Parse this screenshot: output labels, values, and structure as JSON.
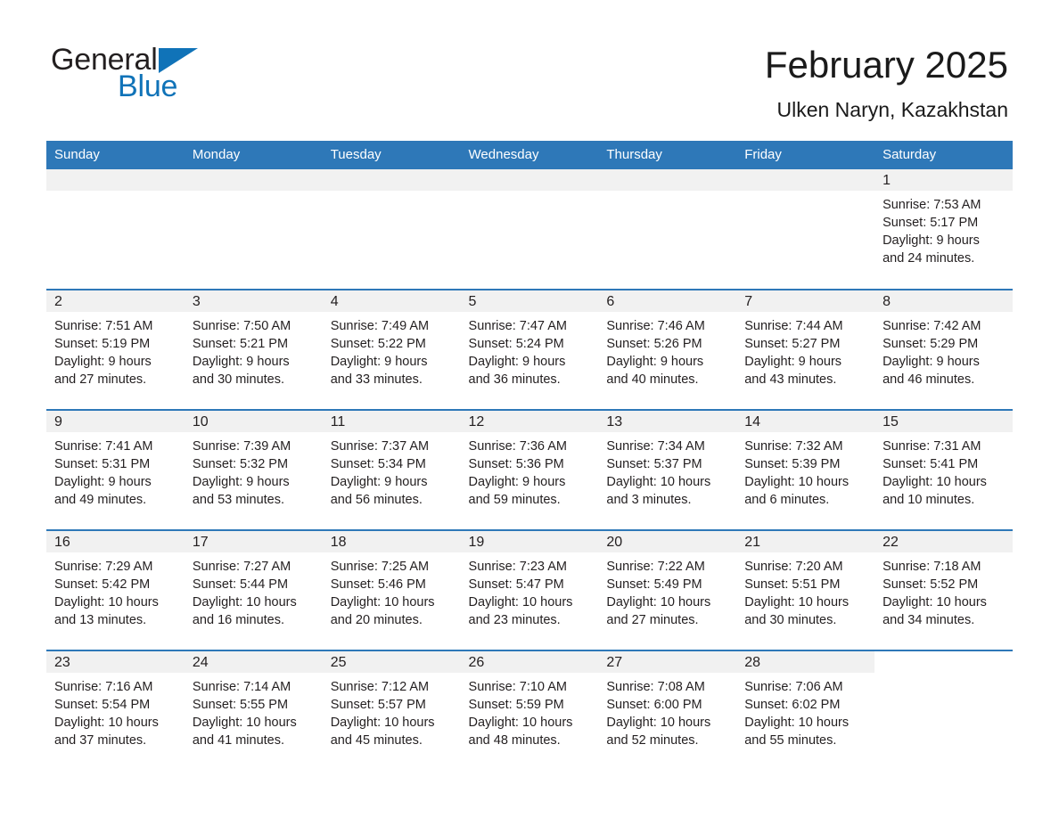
{
  "logo": {
    "word_primary": "General",
    "word_secondary": "Blue",
    "triangle_color": "#1073b8"
  },
  "header": {
    "title": "February 2025",
    "subtitle": "Ulken Naryn, Kazakhstan"
  },
  "colors": {
    "header_blue": "#2e78b8",
    "row_divider_blue": "#2e78b8",
    "daynum_band": "#f1f1f1",
    "text": "#231f20"
  },
  "calendar": {
    "weekday_headers": [
      "Sunday",
      "Monday",
      "Tuesday",
      "Wednesday",
      "Thursday",
      "Friday",
      "Saturday"
    ],
    "weeks": [
      [
        {
          "blank": true
        },
        {
          "blank": true
        },
        {
          "blank": true
        },
        {
          "blank": true
        },
        {
          "blank": true
        },
        {
          "blank": true
        },
        {
          "day": "1",
          "sunrise": "Sunrise: 7:53 AM",
          "sunset": "Sunset: 5:17 PM",
          "daylight": "Daylight: 9 hours and 24 minutes."
        }
      ],
      [
        {
          "day": "2",
          "sunrise": "Sunrise: 7:51 AM",
          "sunset": "Sunset: 5:19 PM",
          "daylight": "Daylight: 9 hours and 27 minutes."
        },
        {
          "day": "3",
          "sunrise": "Sunrise: 7:50 AM",
          "sunset": "Sunset: 5:21 PM",
          "daylight": "Daylight: 9 hours and 30 minutes."
        },
        {
          "day": "4",
          "sunrise": "Sunrise: 7:49 AM",
          "sunset": "Sunset: 5:22 PM",
          "daylight": "Daylight: 9 hours and 33 minutes."
        },
        {
          "day": "5",
          "sunrise": "Sunrise: 7:47 AM",
          "sunset": "Sunset: 5:24 PM",
          "daylight": "Daylight: 9 hours and 36 minutes."
        },
        {
          "day": "6",
          "sunrise": "Sunrise: 7:46 AM",
          "sunset": "Sunset: 5:26 PM",
          "daylight": "Daylight: 9 hours and 40 minutes."
        },
        {
          "day": "7",
          "sunrise": "Sunrise: 7:44 AM",
          "sunset": "Sunset: 5:27 PM",
          "daylight": "Daylight: 9 hours and 43 minutes."
        },
        {
          "day": "8",
          "sunrise": "Sunrise: 7:42 AM",
          "sunset": "Sunset: 5:29 PM",
          "daylight": "Daylight: 9 hours and 46 minutes."
        }
      ],
      [
        {
          "day": "9",
          "sunrise": "Sunrise: 7:41 AM",
          "sunset": "Sunset: 5:31 PM",
          "daylight": "Daylight: 9 hours and 49 minutes."
        },
        {
          "day": "10",
          "sunrise": "Sunrise: 7:39 AM",
          "sunset": "Sunset: 5:32 PM",
          "daylight": "Daylight: 9 hours and 53 minutes."
        },
        {
          "day": "11",
          "sunrise": "Sunrise: 7:37 AM",
          "sunset": "Sunset: 5:34 PM",
          "daylight": "Daylight: 9 hours and 56 minutes."
        },
        {
          "day": "12",
          "sunrise": "Sunrise: 7:36 AM",
          "sunset": "Sunset: 5:36 PM",
          "daylight": "Daylight: 9 hours and 59 minutes."
        },
        {
          "day": "13",
          "sunrise": "Sunrise: 7:34 AM",
          "sunset": "Sunset: 5:37 PM",
          "daylight": "Daylight: 10 hours and 3 minutes."
        },
        {
          "day": "14",
          "sunrise": "Sunrise: 7:32 AM",
          "sunset": "Sunset: 5:39 PM",
          "daylight": "Daylight: 10 hours and 6 minutes."
        },
        {
          "day": "15",
          "sunrise": "Sunrise: 7:31 AM",
          "sunset": "Sunset: 5:41 PM",
          "daylight": "Daylight: 10 hours and 10 minutes."
        }
      ],
      [
        {
          "day": "16",
          "sunrise": "Sunrise: 7:29 AM",
          "sunset": "Sunset: 5:42 PM",
          "daylight": "Daylight: 10 hours and 13 minutes."
        },
        {
          "day": "17",
          "sunrise": "Sunrise: 7:27 AM",
          "sunset": "Sunset: 5:44 PM",
          "daylight": "Daylight: 10 hours and 16 minutes."
        },
        {
          "day": "18",
          "sunrise": "Sunrise: 7:25 AM",
          "sunset": "Sunset: 5:46 PM",
          "daylight": "Daylight: 10 hours and 20 minutes."
        },
        {
          "day": "19",
          "sunrise": "Sunrise: 7:23 AM",
          "sunset": "Sunset: 5:47 PM",
          "daylight": "Daylight: 10 hours and 23 minutes."
        },
        {
          "day": "20",
          "sunrise": "Sunrise: 7:22 AM",
          "sunset": "Sunset: 5:49 PM",
          "daylight": "Daylight: 10 hours and 27 minutes."
        },
        {
          "day": "21",
          "sunrise": "Sunrise: 7:20 AM",
          "sunset": "Sunset: 5:51 PM",
          "daylight": "Daylight: 10 hours and 30 minutes."
        },
        {
          "day": "22",
          "sunrise": "Sunrise: 7:18 AM",
          "sunset": "Sunset: 5:52 PM",
          "daylight": "Daylight: 10 hours and 34 minutes."
        }
      ],
      [
        {
          "day": "23",
          "sunrise": "Sunrise: 7:16 AM",
          "sunset": "Sunset: 5:54 PM",
          "daylight": "Daylight: 10 hours and 37 minutes."
        },
        {
          "day": "24",
          "sunrise": "Sunrise: 7:14 AM",
          "sunset": "Sunset: 5:55 PM",
          "daylight": "Daylight: 10 hours and 41 minutes."
        },
        {
          "day": "25",
          "sunrise": "Sunrise: 7:12 AM",
          "sunset": "Sunset: 5:57 PM",
          "daylight": "Daylight: 10 hours and 45 minutes."
        },
        {
          "day": "26",
          "sunrise": "Sunrise: 7:10 AM",
          "sunset": "Sunset: 5:59 PM",
          "daylight": "Daylight: 10 hours and 48 minutes."
        },
        {
          "day": "27",
          "sunrise": "Sunrise: 7:08 AM",
          "sunset": "Sunset: 6:00 PM",
          "daylight": "Daylight: 10 hours and 52 minutes."
        },
        {
          "day": "28",
          "sunrise": "Sunrise: 7:06 AM",
          "sunset": "Sunset: 6:02 PM",
          "daylight": "Daylight: 10 hours and 55 minutes."
        },
        {
          "blank": true
        }
      ]
    ]
  }
}
